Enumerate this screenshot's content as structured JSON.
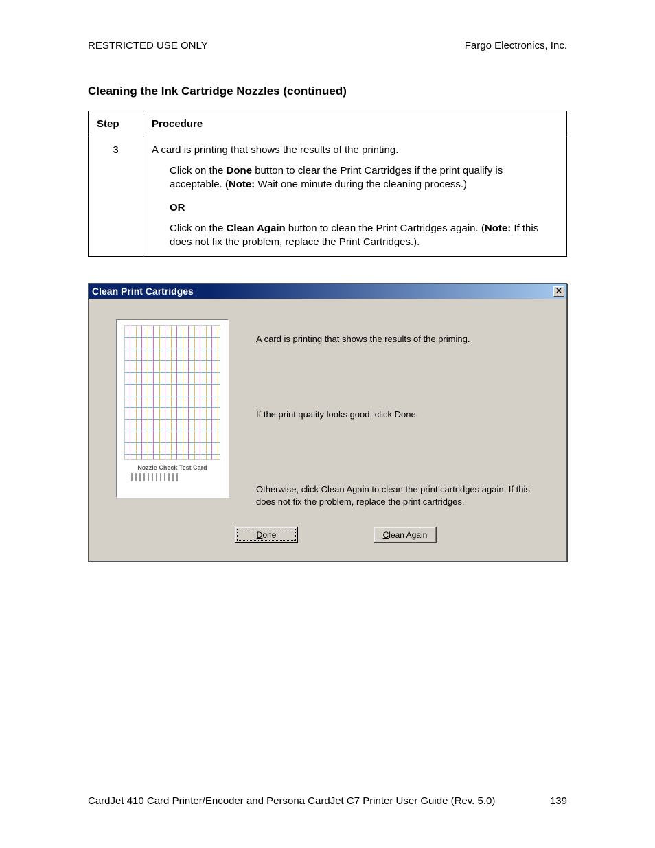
{
  "header": {
    "left": "RESTRICTED USE ONLY",
    "right": "Fargo Electronics, Inc."
  },
  "section_title": "Cleaning the Ink Cartridge Nozzles (continued)",
  "table": {
    "col_step": "Step",
    "col_proc": "Procedure",
    "step_num": "3",
    "line1": "A card is printing that shows the results of the printing.",
    "line2a": "Click on the ",
    "line2b": "Done",
    "line2c": " button to clear the Print Cartridges if the print qualify is acceptable. (",
    "line2d": "Note:",
    "line2e": "  Wait one minute during the cleaning process.)",
    "or": "OR",
    "line3a": "Click on the ",
    "line3b": "Clean Again",
    "line3c": " button to clean the Print Cartridges again. (",
    "line3d": "Note:",
    "line3e": " If this does not fix the problem, replace the Print Cartridges.)."
  },
  "dialog": {
    "title": "Clean Print Cartridges",
    "close": "✕",
    "card_label": "Nozzle Check Test Card",
    "p1": "A card is printing that shows the results of the priming.",
    "p2": "If the print quality looks good, click Done.",
    "p3": "Otherwise, click Clean Again to clean the print cartridges again.  If this does not fix the problem, replace the print cartridges.",
    "btn_done": "Done",
    "btn_clean": "Clean Again"
  },
  "footer": {
    "text": "CardJet 410 Card Printer/Encoder and Persona CardJet C7 Printer User Guide (Rev. 5.0)",
    "page": "139"
  }
}
